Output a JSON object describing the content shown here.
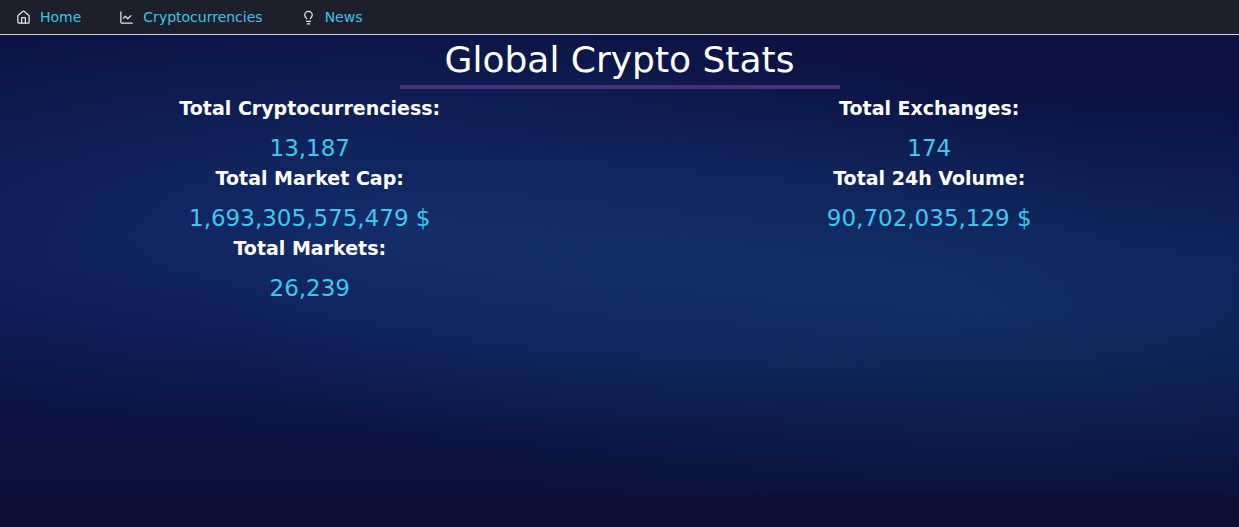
{
  "nav": {
    "items": [
      {
        "label": "Home",
        "icon": "home"
      },
      {
        "label": "Cryptocurrencies",
        "icon": "chart"
      },
      {
        "label": "News",
        "icon": "bulb"
      }
    ]
  },
  "page": {
    "title": "Global Crypto Stats"
  },
  "stats": {
    "columns": [
      {
        "items": [
          {
            "label": "Total Cryptocurrenciess:",
            "value": "13,187"
          },
          {
            "label": "Total Market Cap:",
            "value": "1,693,305,575,479 $"
          },
          {
            "label": "Total Markets:",
            "value": "26,239"
          }
        ]
      },
      {
        "items": [
          {
            "label": "Total Exchanges:",
            "value": "174"
          },
          {
            "label": "Total 24h Volume:",
            "value": "90,702,035,129 $"
          }
        ]
      }
    ]
  }
}
